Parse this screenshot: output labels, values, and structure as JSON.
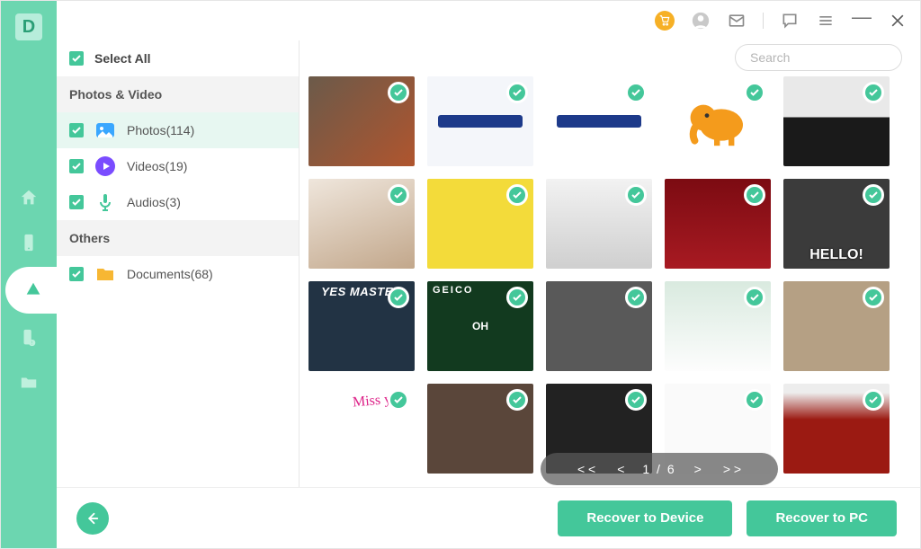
{
  "app": {
    "logo_letter": "D"
  },
  "titlebar": {
    "icons": {
      "cart": "cart-icon",
      "user": "user-icon",
      "mail": "mail-icon",
      "feedback": "feedback-icon",
      "menu": "menu-icon",
      "minimize": "minimize-icon",
      "close": "close-icon"
    }
  },
  "search": {
    "placeholder": "Search"
  },
  "sidebar": {
    "select_all": "Select All",
    "section_photos_video": "Photos & Video",
    "section_others": "Others",
    "items": {
      "photos": {
        "label": "Photos(114)",
        "checked": true,
        "active": true
      },
      "videos": {
        "label": "Videos(19)",
        "checked": true
      },
      "audios": {
        "label": "Audios(3)",
        "checked": true
      },
      "documents": {
        "label": "Documents(68)",
        "checked": true
      }
    }
  },
  "grid": {
    "thumbs": [
      {
        "id": "t1",
        "caption": "",
        "klass": "pf-photo"
      },
      {
        "id": "t2",
        "caption": "",
        "klass": "pf-login"
      },
      {
        "id": "t3",
        "caption": "",
        "klass": "pf-login2"
      },
      {
        "id": "t4",
        "caption": "",
        "klass": "pf-eleph"
      },
      {
        "id": "t5",
        "caption": "",
        "klass": "pf-mouse"
      },
      {
        "id": "t6",
        "caption": "",
        "klass": "pf-cat"
      },
      {
        "id": "t7",
        "caption": "",
        "klass": "pf-sponge"
      },
      {
        "id": "t8",
        "caption": "",
        "klass": "pf-printer"
      },
      {
        "id": "t9",
        "caption": "",
        "klass": "pf-curtain"
      },
      {
        "id": "t10",
        "caption": "HELLO!",
        "klass": "pf-hello"
      },
      {
        "id": "t11",
        "caption": "",
        "klass": "pf-yesm",
        "overlay_top": "YES MASTER"
      },
      {
        "id": "t12",
        "caption": "",
        "klass": "pf-geico",
        "geico": "GEICO",
        "oh": "OH"
      },
      {
        "id": "t13",
        "caption": "",
        "klass": "pf-car"
      },
      {
        "id": "t14",
        "caption": "",
        "klass": "pf-desk"
      },
      {
        "id": "t15",
        "caption": "",
        "klass": "pf-man"
      },
      {
        "id": "t16",
        "caption": "",
        "klass": "pf-miss",
        "miss": "Miss you"
      },
      {
        "id": "t17",
        "caption": "",
        "klass": "pf-monkey"
      },
      {
        "id": "t18",
        "caption": "",
        "klass": "pf-keyb"
      },
      {
        "id": "t19",
        "caption": "",
        "klass": "pf-app"
      },
      {
        "id": "t20",
        "caption": "",
        "klass": "pf-red"
      }
    ]
  },
  "pager": {
    "first": "< <",
    "prev": "<",
    "label": "1 / 6",
    "next": ">",
    "last": "> >"
  },
  "footer": {
    "recover_device": "Recover to Device",
    "recover_pc": "Recover to PC"
  }
}
